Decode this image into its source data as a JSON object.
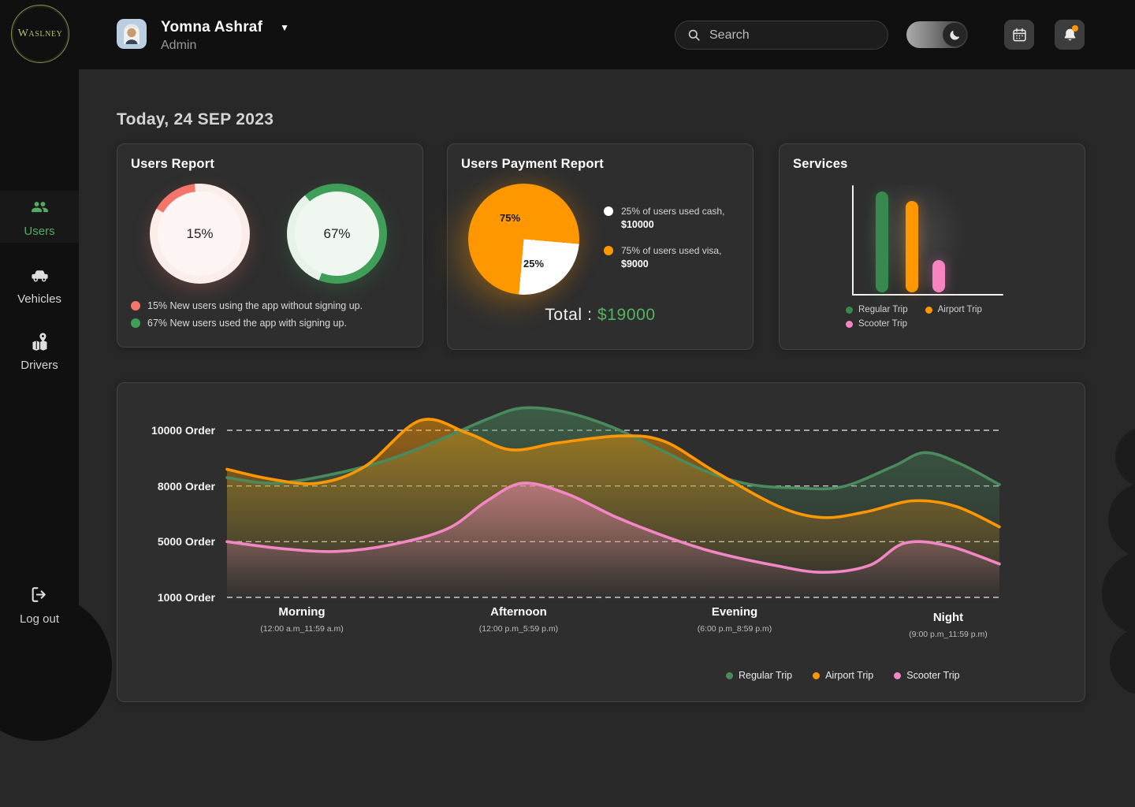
{
  "brand": {
    "name": "Waslney"
  },
  "header": {
    "user": {
      "name": "Yomna Ashraf",
      "role": "Admin"
    },
    "search": {
      "placeholder": "Search"
    }
  },
  "sidebar": {
    "items": [
      {
        "id": "users",
        "label": "Users",
        "active": true
      },
      {
        "id": "vehicles",
        "label": "Vehicles",
        "active": false
      },
      {
        "id": "drivers",
        "label": "Drivers",
        "active": false
      }
    ],
    "logout": {
      "label": "Log out"
    }
  },
  "main": {
    "date_heading": "Today, 24 SEP 2023"
  },
  "chart_data": [
    {
      "id": "users-report-no-signup",
      "type": "donut",
      "title": "Users Report",
      "value": 15,
      "label": "15%",
      "legend": "15%  New users using the app without signing up.",
      "color": "#f4756a",
      "track_color": "#fbeeea",
      "hole_color": "#fdf5f3",
      "start_deg": -60
    },
    {
      "id": "users-report-signup",
      "type": "donut",
      "value": 67,
      "label": "67%",
      "legend": "67% New users used the app with signing up.",
      "color": "#3f9e57",
      "track_color": "#e7f3e9",
      "hole_color": "#eff7f0",
      "start_deg": -40
    },
    {
      "id": "users-payment-report",
      "type": "pie",
      "title": "Users Payment Report",
      "start_deg": 95,
      "slices": [
        {
          "name": "cash",
          "pct": 25,
          "label": "25%",
          "legend_line1": "25% of users used cash,",
          "legend_line2": "$10000",
          "color": "#ffffff"
        },
        {
          "name": "visa",
          "pct": 75,
          "label": "75%",
          "legend_line1": "75% of users used visa,",
          "legend_line2": "$9000",
          "color": "#ff9800"
        }
      ],
      "total_label": "Total :",
      "total_value": "$19000",
      "total_color": "#55b45f"
    },
    {
      "id": "services",
      "type": "bar",
      "title": "Services",
      "categories": [
        "Regular Trip",
        "Airport Trip",
        "Scooter Trip"
      ],
      "values": [
        100,
        91,
        32
      ],
      "colors": [
        "#37894e",
        "#ff9800",
        "#f783c0"
      ]
    },
    {
      "id": "orders-by-daytime",
      "type": "line",
      "y_ticks": [
        {
          "label": "10000 Order",
          "value": 10000
        },
        {
          "label": "8000 Order",
          "value": 8000
        },
        {
          "label": "5000 Order",
          "value": 5000
        },
        {
          "label": "1000 Order",
          "value": 1000
        }
      ],
      "x_categories": [
        {
          "label": "Morning",
          "sub": "(12:00 a.m_11:59 a.m)"
        },
        {
          "label": "Afternoon",
          "sub": "(12:00 p.m_5:59 p.m)"
        },
        {
          "label": "Evening",
          "sub": "(6:00 p.m_8:59 p.m)"
        },
        {
          "label": "Night",
          "sub": "(9:00 p.m_11:59 p.m)"
        }
      ],
      "series": [
        {
          "name": "Regular Trip",
          "color": "#4a8a5c",
          "points": [
            [
              0,
              8300
            ],
            [
              60,
              8100
            ],
            [
              130,
              8400
            ],
            [
              200,
              8900
            ],
            [
              265,
              9600
            ],
            [
              330,
              10400
            ],
            [
              375,
              10800
            ],
            [
              430,
              10650
            ],
            [
              490,
              10100
            ],
            [
              550,
              9300
            ],
            [
              610,
              8500
            ],
            [
              665,
              8050
            ],
            [
              720,
              7900
            ],
            [
              780,
              7950
            ],
            [
              845,
              8700
            ],
            [
              885,
              9200
            ],
            [
              930,
              8800
            ],
            [
              980,
              8050
            ]
          ]
        },
        {
          "name": "Airport Trip",
          "color": "#ff9800",
          "points": [
            [
              0,
              8600
            ],
            [
              55,
              8250
            ],
            [
              115,
              8100
            ],
            [
              175,
              8700
            ],
            [
              245,
              10350
            ],
            [
              305,
              9900
            ],
            [
              360,
              9300
            ],
            [
              420,
              9550
            ],
            [
              500,
              9800
            ],
            [
              555,
              9600
            ],
            [
              620,
              8500
            ],
            [
              700,
              6900
            ],
            [
              755,
              6300
            ],
            [
              810,
              6600
            ],
            [
              870,
              7200
            ],
            [
              925,
              6900
            ],
            [
              980,
              5800
            ]
          ]
        },
        {
          "name": "Scooter Trip",
          "color": "#f287c5",
          "points": [
            [
              0,
              5000
            ],
            [
              70,
              4500
            ],
            [
              140,
              4300
            ],
            [
              210,
              4800
            ],
            [
              280,
              5700
            ],
            [
              330,
              7200
            ],
            [
              375,
              8100
            ],
            [
              430,
              7600
            ],
            [
              495,
              6300
            ],
            [
              555,
              5300
            ],
            [
              615,
              4300
            ],
            [
              695,
              3300
            ],
            [
              755,
              2800
            ],
            [
              815,
              3300
            ],
            [
              860,
              4900
            ],
            [
              915,
              4700
            ],
            [
              980,
              3400
            ]
          ]
        }
      ]
    }
  ]
}
